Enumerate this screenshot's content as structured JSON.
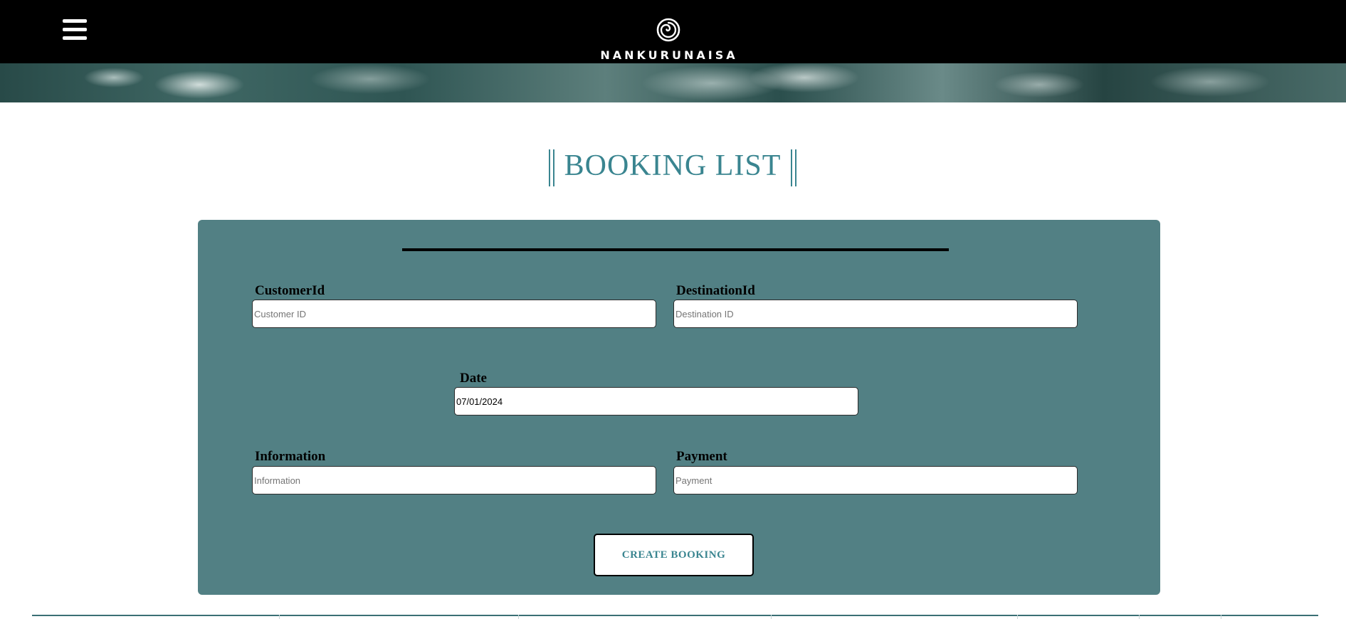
{
  "header": {
    "logo_text": "NANKURUNAISA",
    "logo_icon": "spiral-icon",
    "menu_icon": "hamburger-menu-icon"
  },
  "page": {
    "title": "BOOKING LIST"
  },
  "form": {
    "customer_id": {
      "label": "CustomerId",
      "placeholder": "Customer ID",
      "value": ""
    },
    "destination_id": {
      "label": "DestinationId",
      "placeholder": "Destination ID",
      "value": ""
    },
    "date": {
      "label": "Date",
      "value": "07/01/2024"
    },
    "information": {
      "label": "Information",
      "placeholder": "Information",
      "value": ""
    },
    "payment": {
      "label": "Payment",
      "placeholder": "Payment",
      "value": ""
    },
    "submit_label": "CREATE BOOKING"
  },
  "colors": {
    "header_bg": "#000000",
    "accent": "#3a8590",
    "panel_bg": "#528084"
  }
}
